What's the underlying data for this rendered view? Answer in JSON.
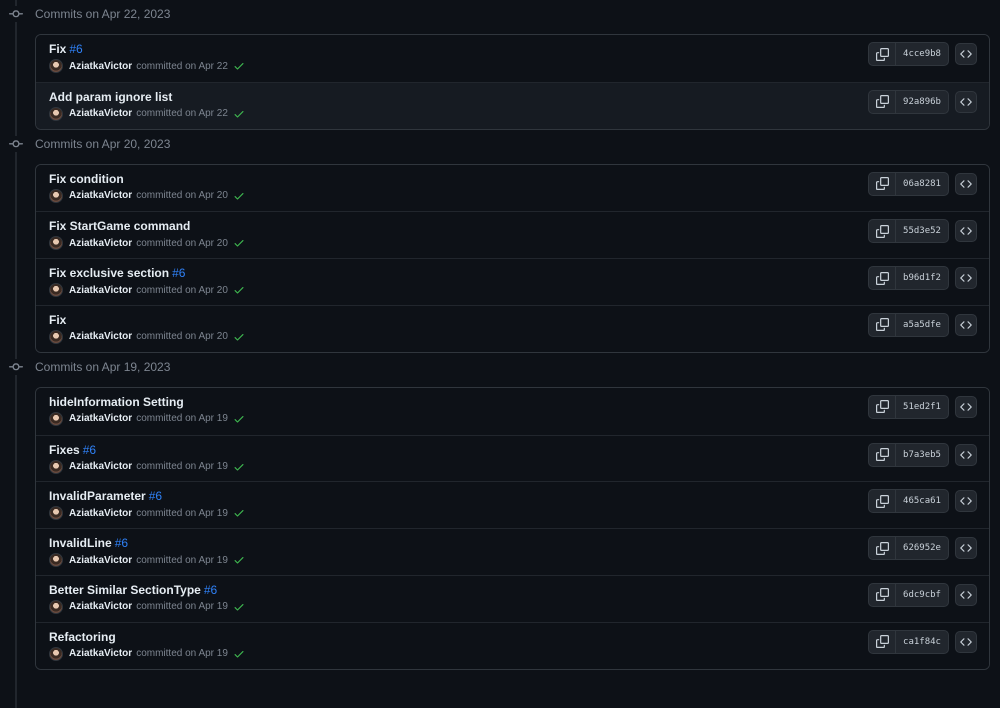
{
  "groups": [
    {
      "header": "Commits on Apr 22, 2023",
      "commits": [
        {
          "title": "Fix",
          "issue": "#6",
          "author": "AziatkaVictor",
          "meta": "committed on Apr 22",
          "sha": "4cce9b8"
        },
        {
          "title": "Add param ignore list",
          "issue": "",
          "author": "AziatkaVictor",
          "meta": "committed on Apr 22",
          "sha": "92a896b"
        }
      ]
    },
    {
      "header": "Commits on Apr 20, 2023",
      "commits": [
        {
          "title": "Fix condition",
          "issue": "",
          "author": "AziatkaVictor",
          "meta": "committed on Apr 20",
          "sha": "06a8281"
        },
        {
          "title": "Fix StartGame command",
          "issue": "",
          "author": "AziatkaVictor",
          "meta": "committed on Apr 20",
          "sha": "55d3e52"
        },
        {
          "title": "Fix exclusive section",
          "issue": "#6",
          "author": "AziatkaVictor",
          "meta": "committed on Apr 20",
          "sha": "b96d1f2"
        },
        {
          "title": "Fix",
          "issue": "",
          "author": "AziatkaVictor",
          "meta": "committed on Apr 20",
          "sha": "a5a5dfe"
        }
      ]
    },
    {
      "header": "Commits on Apr 19, 2023",
      "commits": [
        {
          "title": "hideInformation Setting",
          "issue": "",
          "author": "AziatkaVictor",
          "meta": "committed on Apr 19",
          "sha": "51ed2f1"
        },
        {
          "title": "Fixes",
          "issue": "#6",
          "author": "AziatkaVictor",
          "meta": "committed on Apr 19",
          "sha": "b7a3eb5"
        },
        {
          "title": "InvalidParameter",
          "issue": "#6",
          "author": "AziatkaVictor",
          "meta": "committed on Apr 19",
          "sha": "465ca61"
        },
        {
          "title": "InvalidLine",
          "issue": "#6",
          "author": "AziatkaVictor",
          "meta": "committed on Apr 19",
          "sha": "626952e"
        },
        {
          "title": "Better Similar SectionType",
          "issue": "#6",
          "author": "AziatkaVictor",
          "meta": "committed on Apr 19",
          "sha": "6dc9cbf"
        },
        {
          "title": "Refactoring",
          "issue": "",
          "author": "AziatkaVictor",
          "meta": "committed on Apr 19",
          "sha": "ca1f84c"
        }
      ]
    }
  ],
  "icons": {
    "commit": "git-commit-icon",
    "copy": "copy-icon",
    "browse": "code-icon",
    "status": "check-icon"
  },
  "colors": {
    "background": "#0d1117",
    "border": "#30363d",
    "link": "#2f81f7",
    "success": "#3fb950",
    "muted": "#7d8590"
  }
}
